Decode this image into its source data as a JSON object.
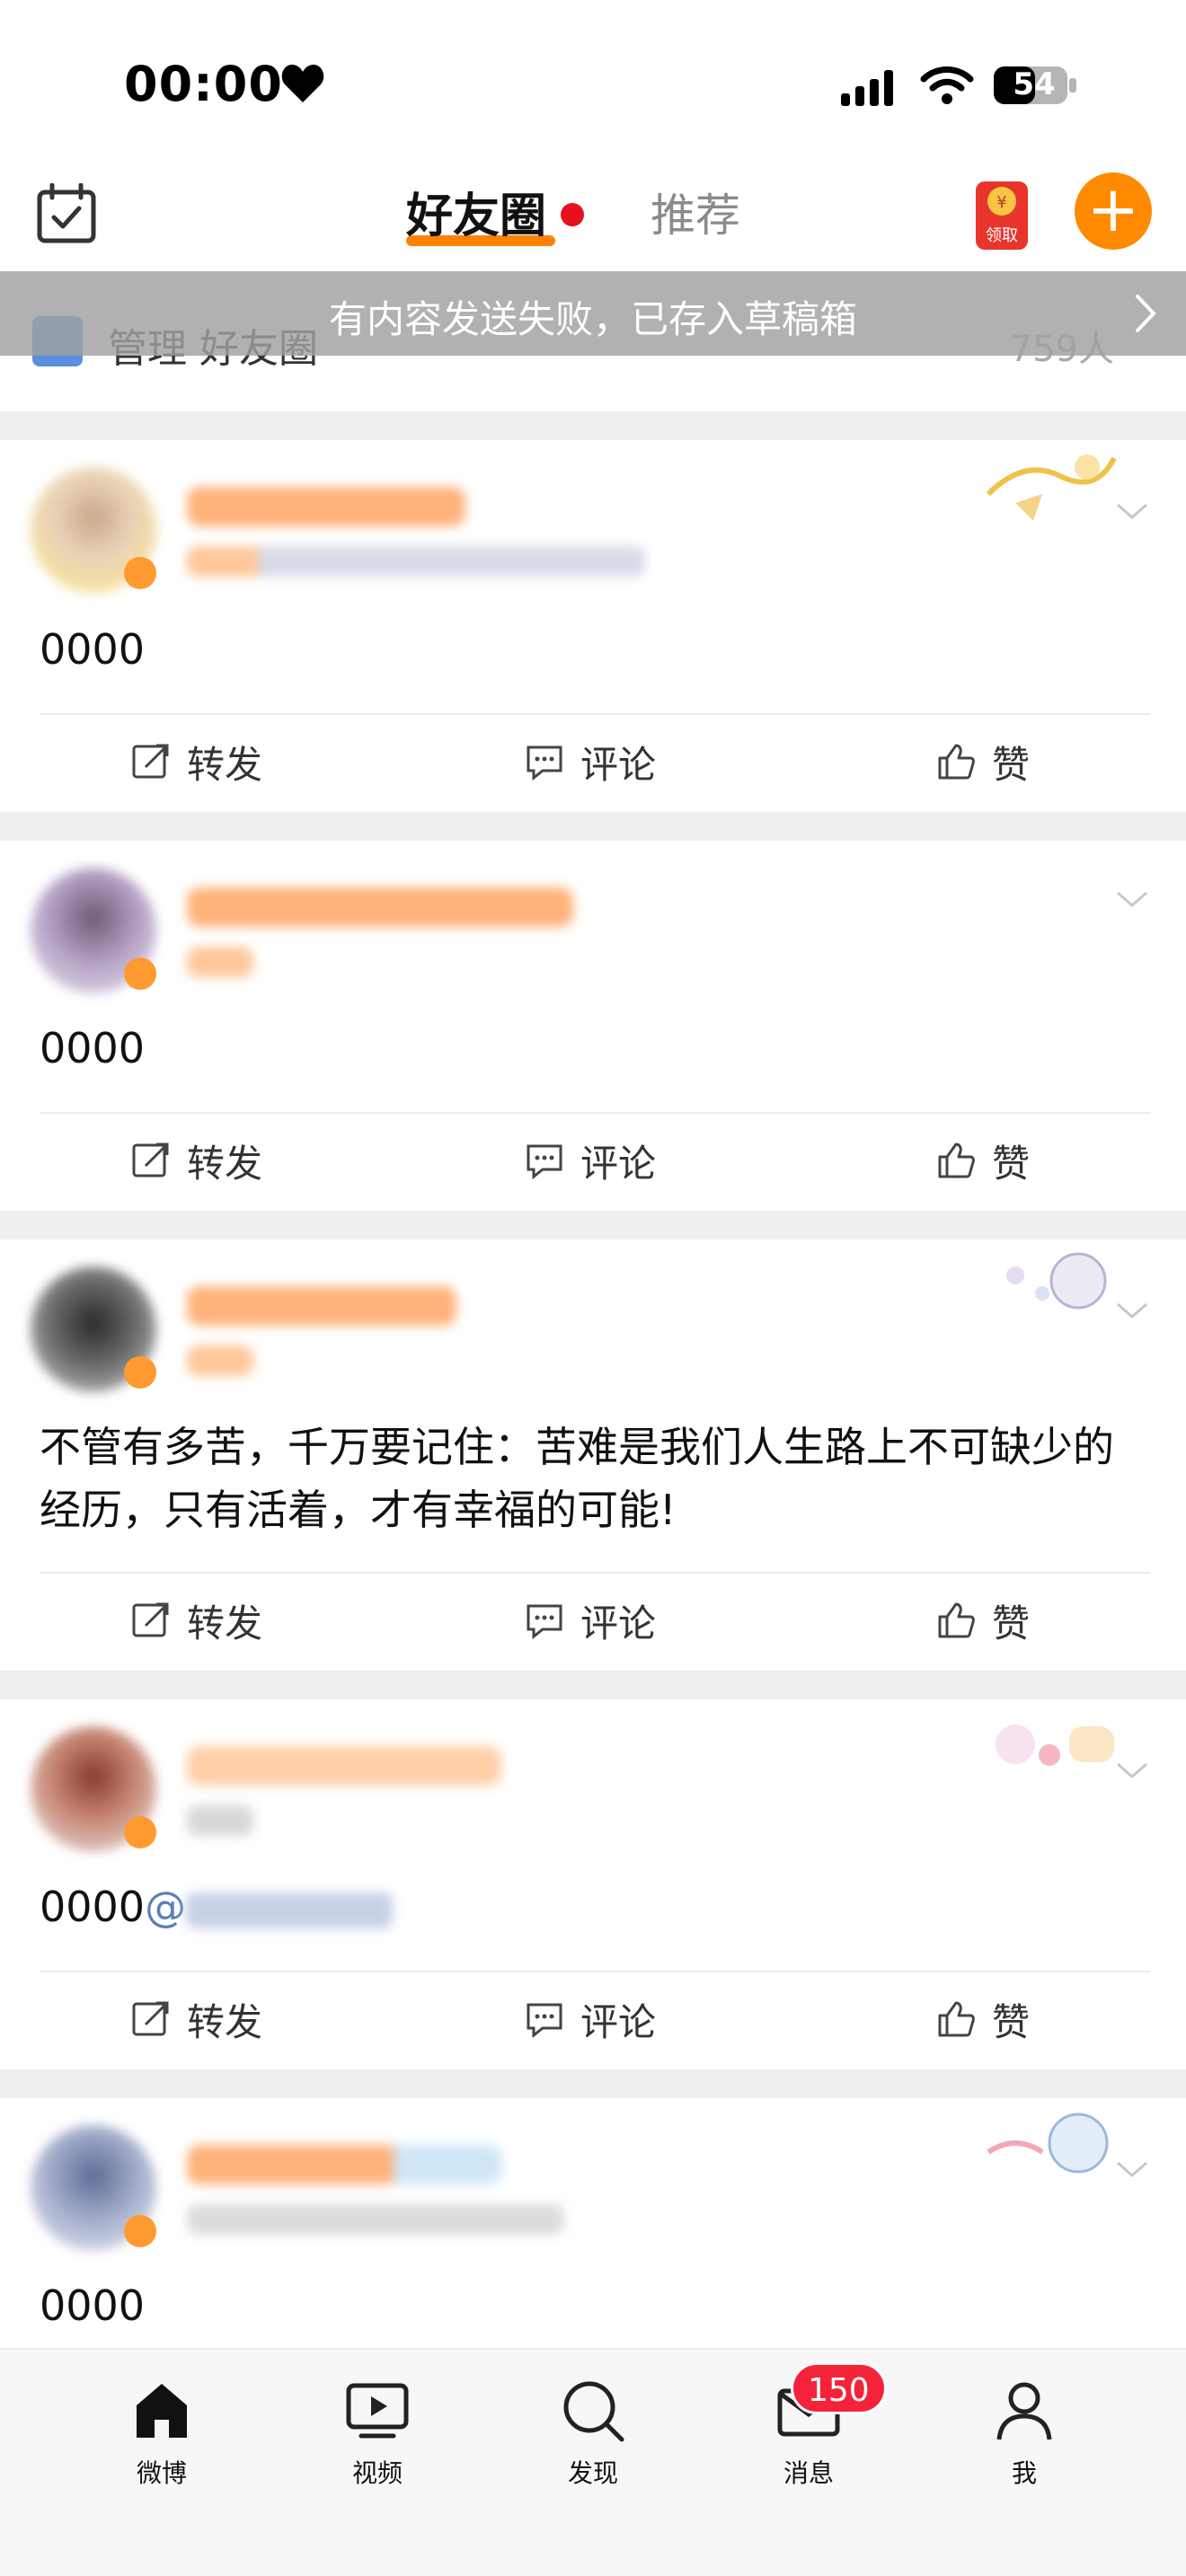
{
  "status_bar": {
    "time": "00:00",
    "battery": "54"
  },
  "header": {
    "tab_friends": "好友圈",
    "tab_recommend": "推荐",
    "coupon_label": "领取",
    "add_label": "+"
  },
  "manage_row": {
    "label": "管理 好友圈",
    "count": "759人"
  },
  "toast": {
    "text": "有内容发送失败，已存入草稿箱"
  },
  "actions": {
    "repost": "转发",
    "comment": "评论",
    "like": "赞"
  },
  "posts": [
    {
      "text": "0000"
    },
    {
      "text": "0000"
    },
    {
      "text": "不管有多苦，千万要记住：苦难是我们人生路上不可缺少的经历，只有活着，才有幸福的可能!"
    },
    {
      "text": "0000",
      "mention": "@"
    },
    {
      "text": "0000"
    }
  ],
  "bottom_nav": [
    {
      "label": "微博",
      "icon": "home-icon"
    },
    {
      "label": "视频",
      "icon": "video-icon"
    },
    {
      "label": "发现",
      "icon": "search-icon"
    },
    {
      "label": "消息",
      "icon": "mail-icon"
    },
    {
      "label": "我",
      "icon": "profile-icon"
    }
  ],
  "message_badge": "150",
  "colors": {
    "accent": "#ff8200",
    "badge": "#f4233a",
    "toast": "#a0a0a0"
  }
}
